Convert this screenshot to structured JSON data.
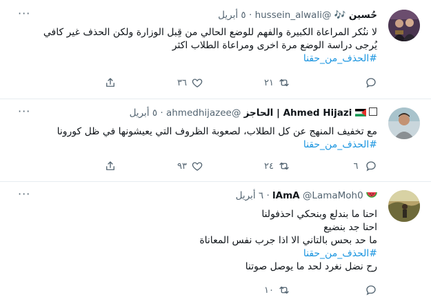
{
  "tweets": [
    {
      "name": "حُسين",
      "handle": "@hussein_alwali",
      "date": "٥ أبريل",
      "lines": [
        "لا ننُكر المراعاة الكبيرة والفهم للوضع الحالي من قِبل الوزارة ولكن الحذف غير كافي",
        "يُرجى دراسة الوضع مرة اخرى ومراعاة الطلاب اكثر"
      ],
      "hashtag": "#الحذف_من_حقنا",
      "reply_count": "",
      "retweet_count": "٢١",
      "like_count": "٣٦"
    },
    {
      "name": "Ahmed Hijazi | الحاجز",
      "handle": "@ahmedhijazee",
      "date": "٥ أبريل",
      "lines": [
        "مع تخفيف المنهج عن كل الطلاب، لصعوبة الظروف التي يعيشونها في ظل كورونا"
      ],
      "hashtag": "#الحذف_من_حقنا",
      "reply_count": "٦",
      "retweet_count": "٢٤",
      "like_count": "٩٣"
    },
    {
      "name": "lAmA",
      "handle": "@LamaMoh0",
      "date": "٦ أبريل",
      "lines": [
        "احنا ما بندلع وبنحكي احذفولنا",
        "احنا جد بنضيع",
        "ما حد بحس بالتاني الا اذا جرب نفس المعاناة"
      ],
      "hashtag": "#الحذف_من_حقنا",
      "closing": "رح نضل  نغرد لحد ما يوصل صوتنا",
      "reply_count": "",
      "retweet_count": "١٠",
      "like_count": ""
    }
  ],
  "ui": {
    "dot": "·",
    "more": "···"
  },
  "icons": [
    "reply-icon",
    "retweet-icon",
    "like-icon",
    "share-icon",
    "more-icon",
    "music-notes-icon",
    "palestine-flag-icon",
    "watermelon-icon"
  ],
  "colors": {
    "hashtag": "#1b95e0",
    "muted": "#536471",
    "divider": "#e6ecf0"
  }
}
